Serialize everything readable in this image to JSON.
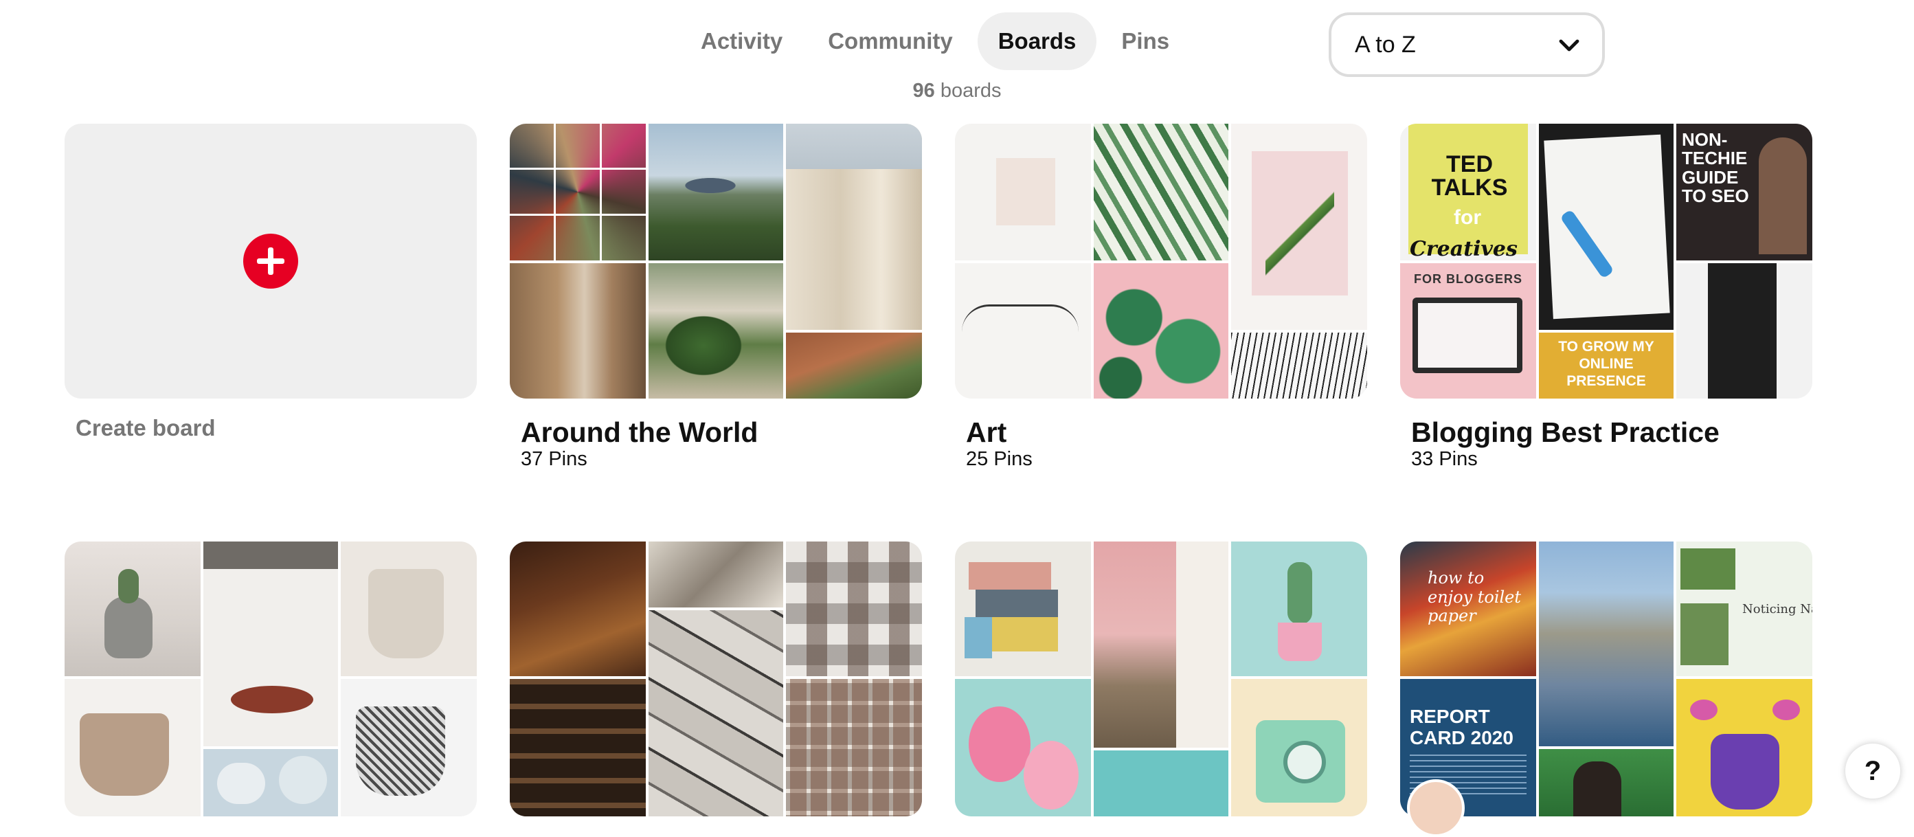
{
  "tabs": [
    {
      "label": "Activity",
      "active": false
    },
    {
      "label": "Community",
      "active": false
    },
    {
      "label": "Boards",
      "active": true
    },
    {
      "label": "Pins",
      "active": false
    }
  ],
  "sort": {
    "selected": "A to Z"
  },
  "summary": {
    "count": "96",
    "unit": "boards"
  },
  "create_board": {
    "label": "Create board"
  },
  "boards": [
    {
      "title": "Around the World",
      "pins": "37 Pins"
    },
    {
      "title": "Art",
      "pins": "25 Pins"
    },
    {
      "title": "Blogging Best Practice",
      "pins": "33 Pins"
    },
    {
      "title": "",
      "pins": ""
    },
    {
      "title": "",
      "pins": ""
    },
    {
      "title": "",
      "pins": ""
    },
    {
      "title": "",
      "pins": ""
    }
  ],
  "cover_text": {
    "ted": "TED TALKS",
    "ted_for": "for",
    "ted_creatives": "Creatives",
    "for_bloggers": "FOR BLOGGERS",
    "seo": "NON-TECHIE GUIDE TO SEO",
    "grow": "TO GROW MY ONLINE PRESENCE",
    "report": "REPORT CARD 2020",
    "toilet": "how to enjoy toilet paper",
    "noticing": "Noticing Natu"
  },
  "help": {
    "label": "?"
  },
  "colors": {
    "brand": "#e60023",
    "muted": "#767676",
    "tab_active_bg": "#efefef"
  }
}
